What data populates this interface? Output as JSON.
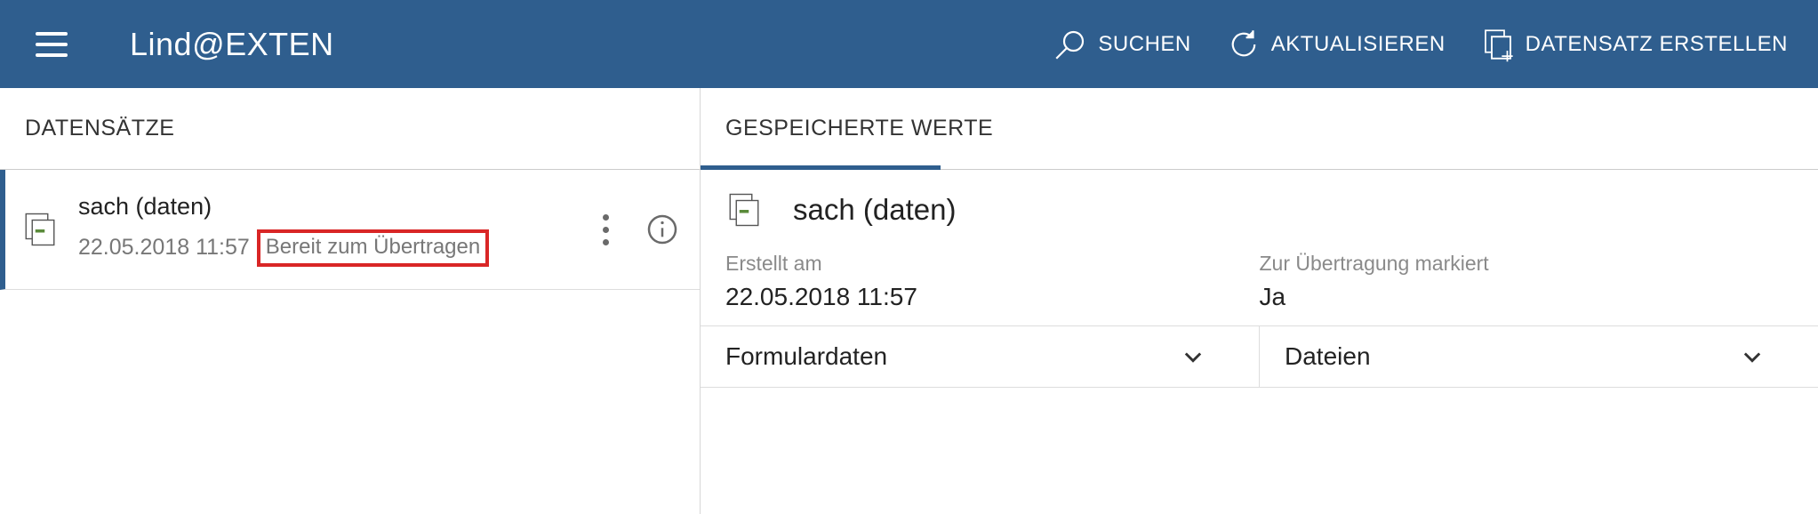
{
  "header": {
    "app_title": "Lind@EXTEN",
    "actions": {
      "search": "SUCHEN",
      "refresh": "AKTUALISIEREN",
      "create": "DATENSATZ ERSTELLEN"
    }
  },
  "left": {
    "title": "DATENSÄTZE",
    "record": {
      "title": "sach (daten)",
      "timestamp": "22.05.2018 11:57",
      "status": "Bereit zum Übertragen"
    }
  },
  "right": {
    "title": "GESPEICHERTE WERTE",
    "detail_title": "sach (daten)",
    "created": {
      "label": "Erstellt am",
      "value": "22.05.2018 11:57"
    },
    "marked": {
      "label": "Zur Übertragung markiert",
      "value": "Ja"
    },
    "section_formdata": "Formulardaten",
    "section_files": "Dateien"
  }
}
